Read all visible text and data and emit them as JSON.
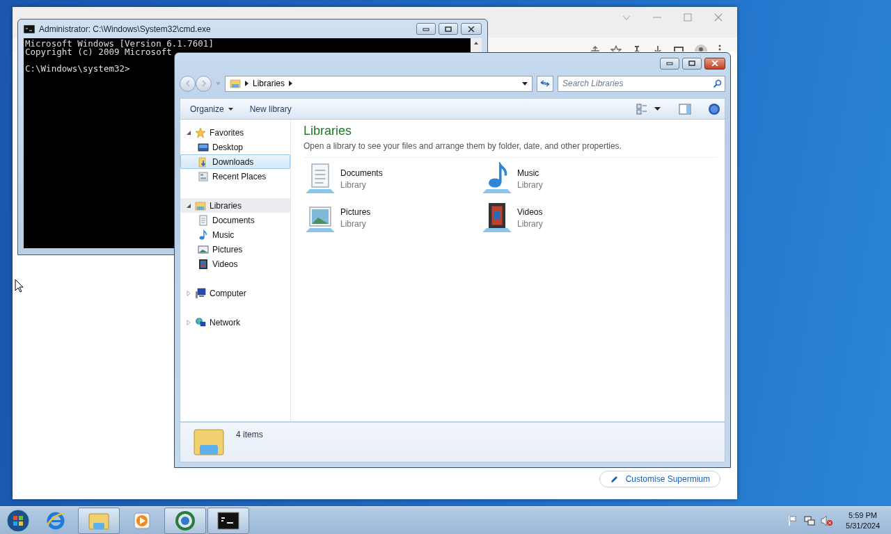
{
  "browser_window": {
    "customize_button": "Customise Supermium"
  },
  "cmd_window": {
    "title": "Administrator: C:\\Windows\\System32\\cmd.exe",
    "lines": [
      {
        "text": "Microsoft Windows [Version 6.1.7601]",
        "kind": "output"
      },
      {
        "text": "Copyright (c) 2009 Microsoft",
        "kind": "output"
      },
      {
        "text": "C:\\Windows\\system32>",
        "kind": "prompt"
      }
    ]
  },
  "explorer_window": {
    "address": "Libraries",
    "search": {
      "placeholder": "Search Libraries"
    },
    "toolbar": [
      {
        "label": "Organize",
        "kind": "menu"
      },
      {
        "label": "New library",
        "kind": "plain"
      }
    ],
    "nav": [
      {
        "label": "Favorites",
        "kind": "star",
        "expanded": true,
        "selected": false,
        "current": false,
        "children": [
          {
            "label": "Desktop",
            "kind": "desktop",
            "selected": false
          },
          {
            "label": "Downloads",
            "kind": "downloads",
            "selected": true
          },
          {
            "label": "Recent Places",
            "kind": "recent",
            "selected": false
          }
        ]
      },
      {
        "label": "Libraries",
        "kind": "libraries",
        "expanded": true,
        "selected": false,
        "current": true,
        "children": [
          {
            "label": "Documents",
            "kind": "documents",
            "selected": false
          },
          {
            "label": "Music",
            "kind": "music",
            "selected": false
          },
          {
            "label": "Pictures",
            "kind": "pictures",
            "selected": false
          },
          {
            "label": "Videos",
            "kind": "videos",
            "selected": false
          }
        ]
      },
      {
        "label": "Computer",
        "kind": "computer",
        "expanded": false,
        "selected": false,
        "current": false
      },
      {
        "label": "Network",
        "kind": "network",
        "expanded": false,
        "selected": false,
        "current": false
      }
    ],
    "content": {
      "title": "Libraries",
      "description": "Open a library to see your files and arrange them by folder, date, and other properties.",
      "items": [
        {
          "name": "Documents",
          "subtitle": "Library",
          "kind": "documents"
        },
        {
          "name": "Music",
          "subtitle": "Library",
          "kind": "music"
        },
        {
          "name": "Pictures",
          "subtitle": "Library",
          "kind": "pictures"
        },
        {
          "name": "Videos",
          "subtitle": "Library",
          "kind": "videos"
        }
      ]
    },
    "status": "4 items"
  },
  "taskbar": {
    "apps": [
      {
        "kind": "ie",
        "running": false
      },
      {
        "kind": "explorer",
        "running": true
      },
      {
        "kind": "media",
        "running": false
      },
      {
        "kind": "browser",
        "running": true
      },
      {
        "kind": "cmd",
        "running": true
      }
    ],
    "time": "5:59 PM",
    "date": "5/31/2024"
  }
}
